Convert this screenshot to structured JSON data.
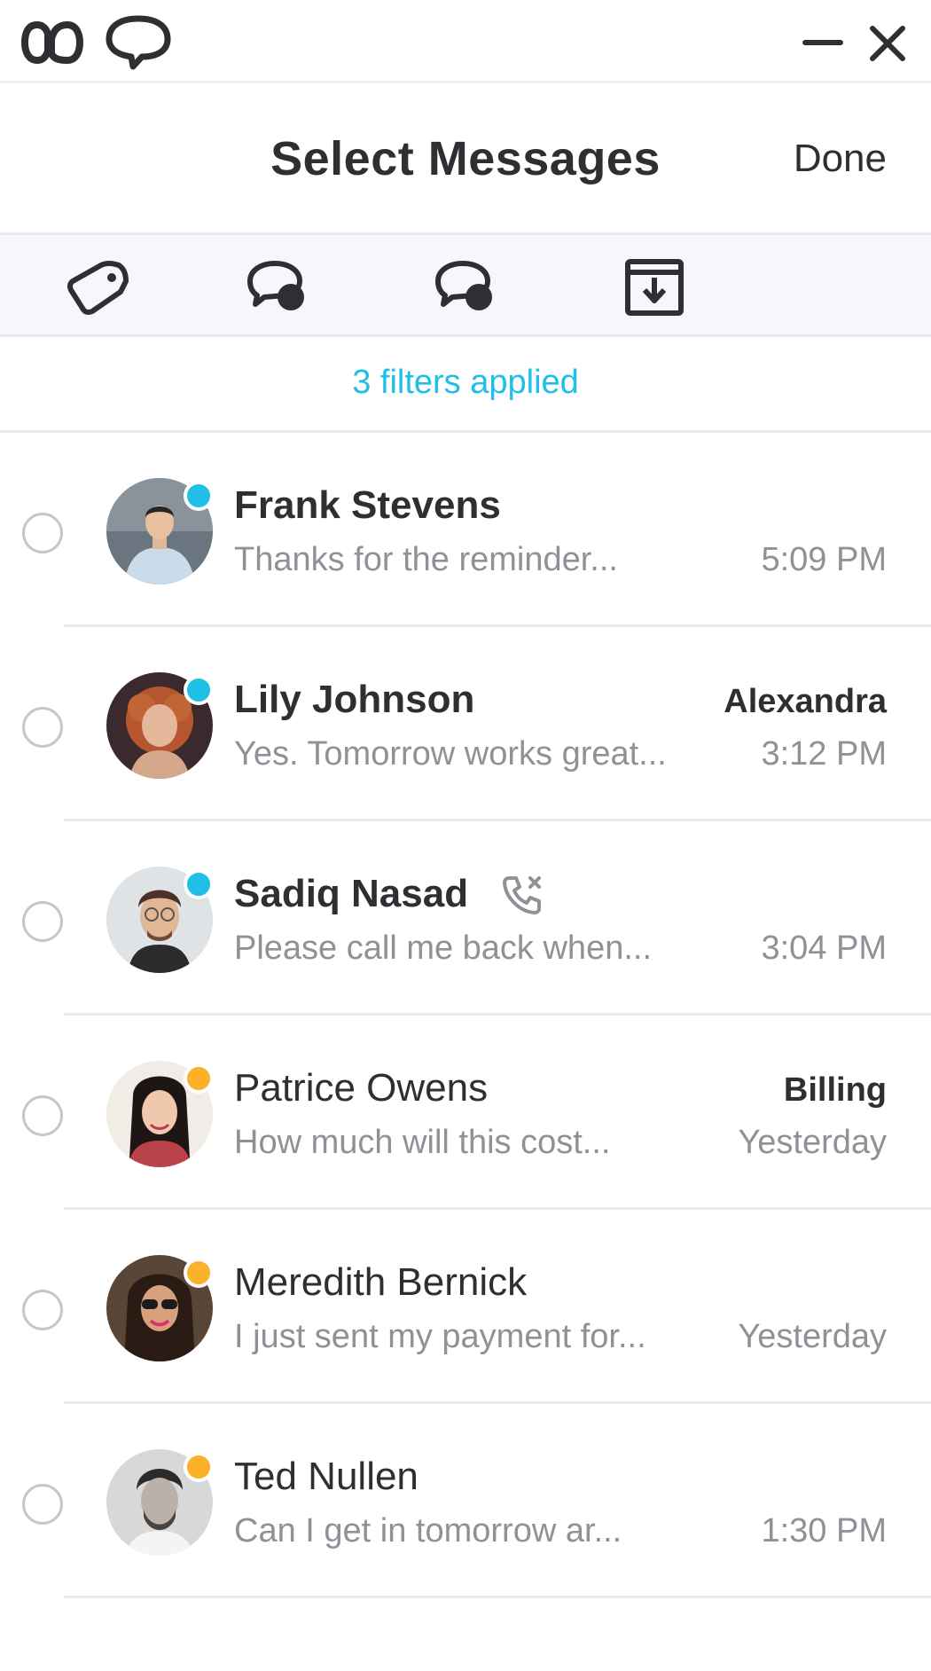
{
  "header": {
    "title": "Select Messages",
    "done_label": "Done"
  },
  "toolbar": {
    "tools": [
      {
        "icon": "tag-icon"
      },
      {
        "icon": "mark-unread-icon"
      },
      {
        "icon": "mark-read-icon"
      },
      {
        "icon": "archive-icon"
      }
    ]
  },
  "filters": {
    "label": "3 filters applied"
  },
  "colors": {
    "accent": "#1fbfe8",
    "status_online": "#1fbfe8",
    "status_away": "#fbb12a",
    "text_primary": "#2d2f33",
    "text_secondary": "#8e9196"
  },
  "conversations": [
    {
      "name": "Frank Stevens",
      "preview": "Thanks for the reminder...",
      "assignee": "",
      "time": "5:09 PM",
      "unread": true,
      "status": "online",
      "missed_call": false,
      "avatar": "avatar-frank"
    },
    {
      "name": "Lily Johnson",
      "preview": "Yes. Tomorrow works great...",
      "assignee": "Alexandra",
      "time": "3:12 PM",
      "unread": true,
      "status": "online",
      "missed_call": false,
      "avatar": "avatar-lily"
    },
    {
      "name": "Sadiq Nasad",
      "preview": "Please call me back when...",
      "assignee": "",
      "time": "3:04 PM",
      "unread": true,
      "status": "online",
      "missed_call": true,
      "avatar": "avatar-sadiq"
    },
    {
      "name": "Patrice Owens",
      "preview": "How much will this cost...",
      "assignee": "Billing",
      "time": "Yesterday",
      "unread": false,
      "status": "away",
      "missed_call": false,
      "avatar": "avatar-patrice"
    },
    {
      "name": "Meredith Bernick",
      "preview": "I just sent my payment for...",
      "assignee": "",
      "time": "Yesterday",
      "unread": false,
      "status": "away",
      "missed_call": false,
      "avatar": "avatar-meredith"
    },
    {
      "name": "Ted Nullen",
      "preview": "Can I get in tomorrow ar...",
      "assignee": "",
      "time": "1:30 PM",
      "unread": false,
      "status": "away",
      "missed_call": false,
      "avatar": "avatar-ted"
    }
  ]
}
